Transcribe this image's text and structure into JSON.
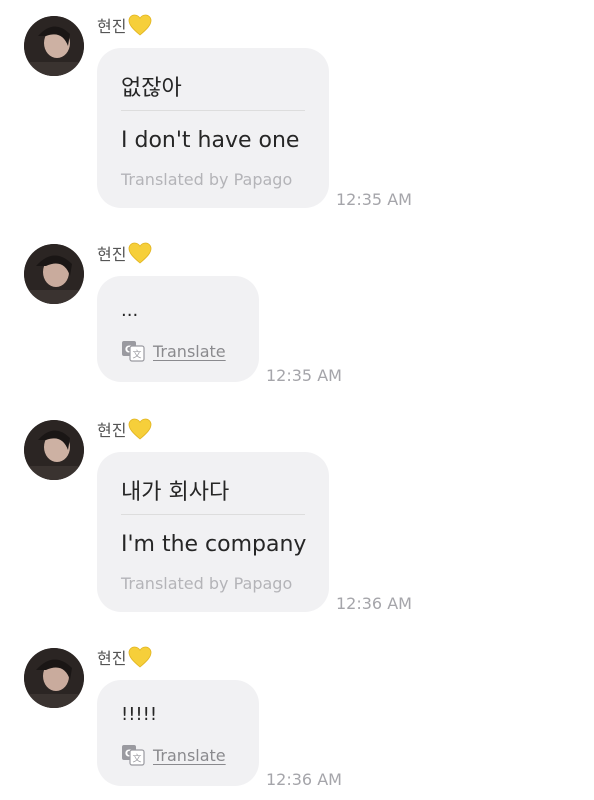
{
  "messages": [
    {
      "sender": "현진",
      "original": "없잖아",
      "translation": "I don't have one",
      "credit": "Translated by Papago",
      "time": "12:35 AM"
    },
    {
      "sender": "현진",
      "original": "...",
      "translate_label": "Translate",
      "time": "12:35 AM"
    },
    {
      "sender": "현진",
      "original": "내가 회사다",
      "translation": "I'm the company",
      "credit": "Translated by Papago",
      "time": "12:36 AM"
    },
    {
      "sender": "현진",
      "original": "!!!!!",
      "translate_label": "Translate",
      "time": "12:36 AM"
    }
  ],
  "colors": {
    "bubble": "#f1f1f3",
    "heart": "#f6cf3a",
    "timestamp": "#a5a5aa"
  },
  "icons": {
    "heart": "yellow-heart-icon",
    "translate": "translate-icon"
  }
}
